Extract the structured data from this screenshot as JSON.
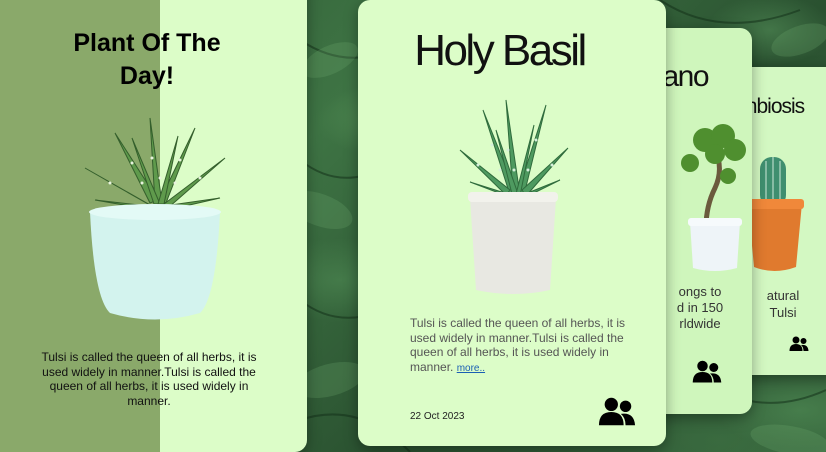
{
  "background": {
    "icon": "leaf-pattern-icon"
  },
  "cards": [
    {
      "title": "Plant Of The Day!",
      "description": "Tulsi is called the queen of all herbs, it is used widely in manner.Tulsi is called the queen of all herbs, it is used widely in manner.",
      "image_icon": "aloe-plant-in-white-pot-icon"
    },
    {
      "title": "Holy Basil",
      "description": "Tulsi is called the queen of all herbs, it is used widely in manner.Tulsi is called the queen of all herbs, it is used widely in manner.",
      "more_label": "more..",
      "date": "22 Oct 2023",
      "group_icon": "people-group-icon",
      "image_icon": "aloe-plant-in-concrete-pot-icon"
    },
    {
      "title": "yano",
      "description": "ongs to\nd in 150\nrldwide",
      "group_icon": "people-group-icon",
      "image_icon": "bonsai-in-white-pot-icon"
    },
    {
      "title": "mbiosis",
      "description": "atural\nTulsi",
      "group_icon": "people-group-icon",
      "image_icon": "cactus-in-orange-pot-icon"
    }
  ],
  "colors": {
    "card_background": "#dcfdc8",
    "dim_overlay": "#8aa96a",
    "link": "#1a5fb4",
    "pot_orange": "#e07a2e"
  }
}
